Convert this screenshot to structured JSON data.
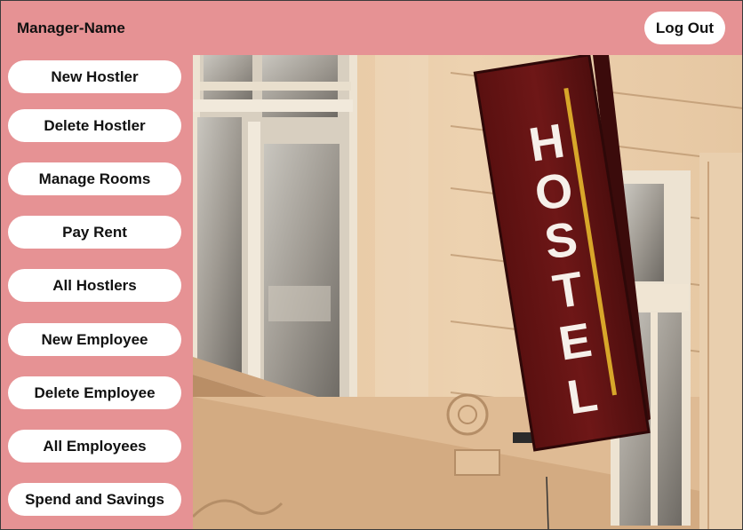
{
  "header": {
    "manager_name": "Manager-Name",
    "logout_label": "Log Out"
  },
  "sidebar": {
    "items": [
      {
        "label": "New Hostler"
      },
      {
        "label": "Delete Hostler"
      },
      {
        "label": "Manage Rooms"
      },
      {
        "label": "Pay Rent"
      },
      {
        "label": "All Hostlers"
      },
      {
        "label": "New Employee"
      },
      {
        "label": "Delete Employee"
      },
      {
        "label": "All Employees"
      },
      {
        "label": "Spend and Savings"
      }
    ]
  },
  "hero": {
    "sign_text": "HOSTEL",
    "sign_letters": [
      "H",
      "O",
      "S",
      "T",
      "E",
      "L"
    ]
  },
  "colors": {
    "background": "#e69294",
    "button": "#ffffff",
    "sign": "#6b1414",
    "sign_stripe": "#d8a72a",
    "facade": "#e8c9a4"
  }
}
